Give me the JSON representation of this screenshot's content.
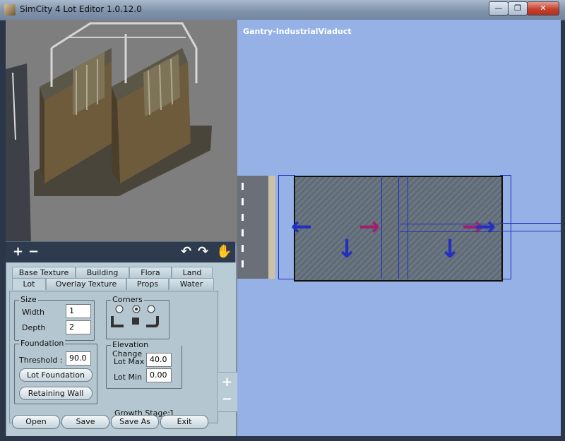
{
  "window": {
    "title": "SimCity 4 Lot Editor 1.0.12.0",
    "caption_buttons": {
      "minimize": "—",
      "maximize": "❐",
      "close": "✕"
    }
  },
  "toolbar": {
    "zoom_in": "+",
    "zoom_out": "−",
    "rotate_left": "↶",
    "rotate_right": "↷",
    "pan": "✋"
  },
  "tabs_row1": [
    "Base Texture",
    "Building",
    "Flora",
    "Land"
  ],
  "tabs_row2": [
    "Lot",
    "Overlay Texture",
    "Props",
    "Water"
  ],
  "active_tab": "Lot",
  "lot": {
    "size": {
      "label": "Size",
      "width_label": "Width",
      "width": "1",
      "depth_label": "Depth",
      "depth": "2"
    },
    "corners_label": "Corners",
    "foundation": {
      "label": "Foundation",
      "threshold_label": "Threshold :",
      "threshold": "90.0",
      "lot_foundation_btn": "Lot Foundation",
      "retaining_wall_btn": "Retaining Wall"
    },
    "elevation": {
      "label": "Elevation Change",
      "lot_max_label": "Lot Max",
      "lot_max": "40.0",
      "lot_min_label": "Lot Min",
      "lot_min": "0.00"
    },
    "growth_stage_label": "Growth Stage:",
    "growth_stage": "1"
  },
  "buttons": {
    "open": "Open",
    "save": "Save",
    "save_as": "Save As",
    "exit": "Exit"
  },
  "side_zoom": {
    "plus": "+",
    "minus": "−"
  },
  "canvas": {
    "lot_name": "Gantry-IndustrialViaduct"
  },
  "colors": {
    "canvas_bg": "#95b1e6",
    "blue_arrow": "#2330bf",
    "magenta_arrow": "#a0206e"
  }
}
